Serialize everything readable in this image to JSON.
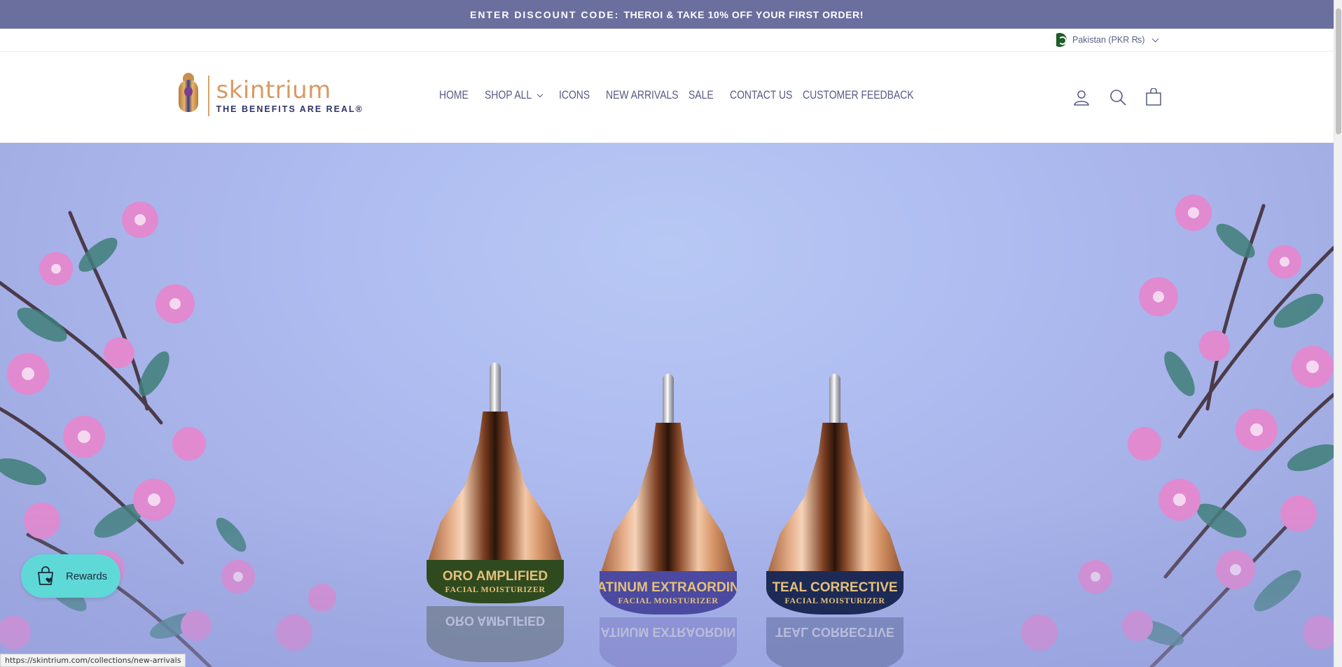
{
  "announcement": {
    "code_label": "ENTER DISCOUNT CODE:",
    "rest": "THEROI & TAKE 10% OFF YOUR FIRST ORDER!"
  },
  "currency": {
    "label": "Pakistan (PKR ₨)"
  },
  "brand": {
    "name": "skintrium",
    "tagline": "THE BENEFITS ARE REAL®"
  },
  "nav": {
    "items": [
      "HOME",
      "SHOP ALL",
      "ICONS",
      "NEW ARRIVALS",
      "SALE",
      "CONTACT US",
      "CUSTOMER FEEDBACK"
    ]
  },
  "header_icons": {
    "account": "user-icon",
    "search": "search-icon",
    "cart": "cart-icon"
  },
  "hero": {
    "products": [
      {
        "name": "ORO AMPLIFIED",
        "sub": "FACIAL MOISTURIZER",
        "band_color": "#2f4a1e"
      },
      {
        "name": "PLATINUM EXTRAORDINAIRE",
        "sub": "FACIAL MOISTURIZER",
        "band_color": "#4b4aa0"
      },
      {
        "name": "TEAL CORRECTIVE",
        "sub": "FACIAL MOISTURIZER",
        "band_color": "#1d2a55"
      }
    ],
    "visible_labels": [
      "ORO AMPLIFIED",
      "ATINUM EXTRAORDIN",
      "TEAL CORRECTIVE"
    ]
  },
  "rewards": {
    "label": "Rewards",
    "icon": "shopping-bag-heart-icon"
  },
  "status_url": "https://skintrium.com/collections/new-arrivals",
  "colors": {
    "announcement_bg": "#6a6f9e",
    "nav_text": "#555a84",
    "rewards_bg": "#5fd8d8",
    "brand_gold": "#d89a63",
    "brand_navy": "#2f3366"
  }
}
